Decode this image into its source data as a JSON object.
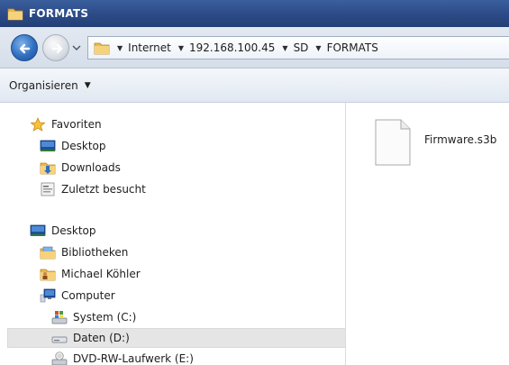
{
  "window": {
    "title": "FORMATS"
  },
  "address": {
    "crumbs": [
      "Internet",
      "192.168.100.45",
      "SD",
      "FORMATS"
    ]
  },
  "toolbar": {
    "organize_label": "Organisieren"
  },
  "nav": {
    "favorites": {
      "label": "Favoriten",
      "items": [
        {
          "label": "Desktop",
          "icon": "desktop-icon"
        },
        {
          "label": "Downloads",
          "icon": "downloads-folder-icon"
        },
        {
          "label": "Zuletzt besucht",
          "icon": "recent-places-icon"
        }
      ]
    },
    "desktop": {
      "label": "Desktop",
      "items": [
        {
          "label": "Bibliotheken",
          "icon": "libraries-icon"
        },
        {
          "label": "Michael Köhler",
          "icon": "user-folder-icon"
        },
        {
          "label": "Computer",
          "icon": "computer-icon"
        }
      ],
      "drives": [
        {
          "label": "System (C:)",
          "icon": "system-drive-icon"
        },
        {
          "label": "Daten (D:)",
          "icon": "drive-icon",
          "selected": true
        },
        {
          "label": "DVD-RW-Laufwerk (E:)",
          "icon": "dvd-drive-icon"
        }
      ]
    }
  },
  "content": {
    "files": [
      {
        "name": "Firmware.s3b",
        "icon": "generic-file-icon"
      }
    ]
  }
}
